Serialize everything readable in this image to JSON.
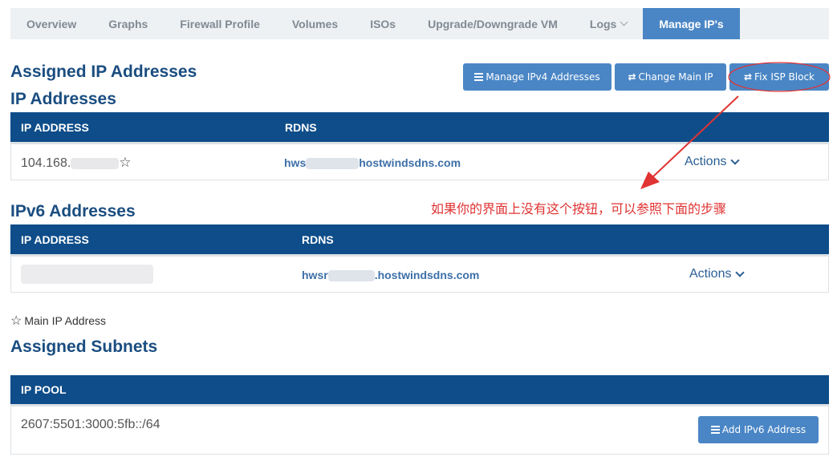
{
  "tabs": [
    {
      "label": "Overview"
    },
    {
      "label": "Graphs"
    },
    {
      "label": "Firewall Profile"
    },
    {
      "label": "Volumes"
    },
    {
      "label": "ISOs"
    },
    {
      "label": "Upgrade/Downgrade VM"
    },
    {
      "label": "Logs"
    },
    {
      "label": "Manage IP's"
    }
  ],
  "headings": {
    "assigned_ip": "Assigned IP Addresses",
    "ip_addresses": "IP Addresses",
    "ipv6": "IPv6 Addresses",
    "subnets": "Assigned Subnets"
  },
  "buttons": {
    "manage_ipv4": "Manage IPv4 Addresses",
    "change_main": "Change Main IP",
    "fix_isp": "Fix ISP Block",
    "add_ipv6": "Add IPv6 Address"
  },
  "ipv4_table": {
    "col_ip": "IP ADDRESS",
    "col_rdns": "RDNS",
    "row": {
      "ip": "104.168.",
      "rdns_prefix": "hws",
      "rdns_suffix": "hostwindsdns.com",
      "actions": "Actions"
    }
  },
  "ipv6_table": {
    "col_ip": "IP ADDRESS",
    "col_rdns": "RDNS",
    "row": {
      "rdns_prefix": "hwsr",
      "rdns_suffix": ".hostwindsdns.com",
      "actions": "Actions"
    }
  },
  "main_ip_note": "Main IP Address",
  "subnets_table": {
    "col_pool": "IP POOL",
    "row": {
      "pool": "2607:5501:3000:5fb::/64"
    }
  },
  "annotation": "如果你的界面上没有这个按钮，可以参照下面的步骤",
  "colors": {
    "accent": "#4a86c5",
    "header": "#0e4d89",
    "heading": "#1a4d80",
    "annotation": "#e03333"
  }
}
